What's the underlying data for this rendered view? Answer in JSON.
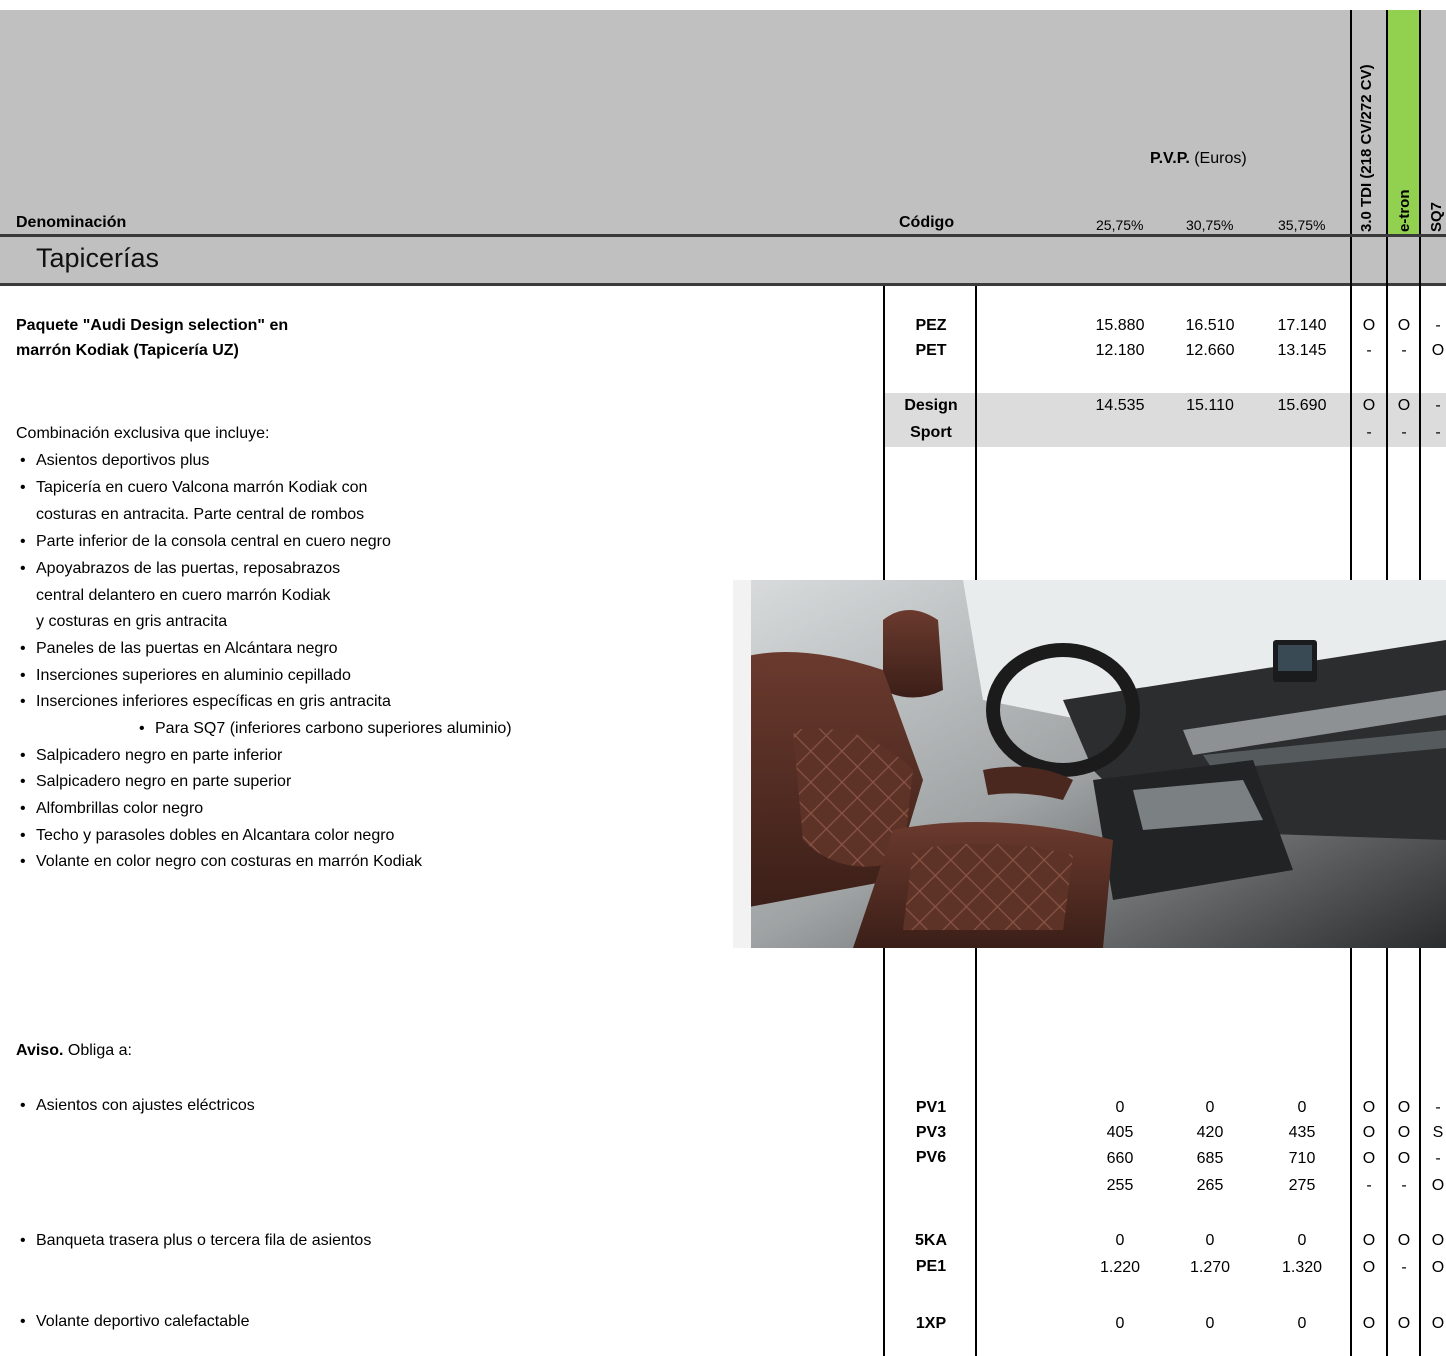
{
  "header": {
    "denominacion": "Denominación",
    "codigo": "Código",
    "pvp_bold": "P.V.P.",
    "pvp_unit": " (Euros)",
    "percents": [
      "25,75%",
      "30,75%",
      "35,75%"
    ],
    "engines": [
      "3.0 TDI (218 CV/272 CV)",
      "e-tron",
      "SQ7"
    ]
  },
  "colors": {
    "header_gray": "#c0c0c0",
    "etron_green": "#92d050",
    "design_band": "#dcdcdc"
  },
  "section": {
    "title": "Tapicerías"
  },
  "package": {
    "title_line1": "Paquete \"Audi Design selection\" en",
    "title_line2": "marrón Kodiak (Tapicería UZ)",
    "rows": [
      {
        "code": "PEZ",
        "prices": [
          "15.880",
          "16.510",
          "17.140"
        ],
        "avail": [
          "O",
          "O",
          "-"
        ]
      },
      {
        "code": "PET",
        "prices": [
          "12.180",
          "12.660",
          "13.145"
        ],
        "avail": [
          "-",
          "-",
          "O"
        ]
      },
      {
        "code": "Design",
        "prices": [
          "14.535",
          "15.110",
          "15.690"
        ],
        "avail": [
          "O",
          "O",
          "-"
        ]
      },
      {
        "code": "Sport",
        "prices": [
          "",
          "",
          ""
        ],
        "avail": [
          "-",
          "-",
          "-"
        ]
      }
    ]
  },
  "description": {
    "intro": "Combinación exclusiva que incluye:",
    "items": [
      "Asientos deportivos plus",
      "Tapicería en cuero Valcona marrón Kodiak con",
      "costuras en antracita. Parte central de rombos",
      "Parte inferior de la consola central en cuero negro",
      "Apoyabrazos de las puertas, reposabrazos",
      "central delantero en cuero marrón Kodiak",
      " y costuras en gris antracita",
      "Paneles de las puertas en Alcántara negro",
      "Inserciones superiores en aluminio cepillado",
      "Inserciones inferiores específicas en gris antracita",
      "Para SQ7 (inferiores carbono superiores aluminio)",
      "Salpicadero negro en parte inferior",
      "Salpicadero negro en parte superior",
      "Alfombrillas color negro",
      "Techo y parasoles dobles en Alcantara color negro",
      "Volante en color negro con costuras en marrón Kodiak"
    ]
  },
  "aviso": {
    "bold": "Aviso.",
    "text": " Obliga a:",
    "groups": [
      {
        "label": "Asientos con ajustes eléctricos",
        "rows": [
          {
            "code": "PV1",
            "prices": [
              "0",
              "0",
              "0"
            ],
            "avail": [
              "O",
              "O",
              "-"
            ]
          },
          {
            "code": "PV3",
            "prices": [
              "405",
              "420",
              "435"
            ],
            "avail": [
              "O",
              "O",
              "S"
            ]
          },
          {
            "code": "PV6",
            "prices": [
              "660",
              "685",
              "710"
            ],
            "avail": [
              "O",
              "O",
              "-"
            ]
          },
          {
            "code": "",
            "prices": [
              "255",
              "265",
              "275"
            ],
            "avail": [
              "-",
              "-",
              "O"
            ]
          }
        ]
      },
      {
        "label": "Banqueta trasera plus o tercera fila de asientos",
        "rows": [
          {
            "code": "5KA",
            "prices": [
              "0",
              "0",
              "0"
            ],
            "avail": [
              "O",
              "O",
              "O"
            ]
          },
          {
            "code": "PE1",
            "prices": [
              "1.220",
              "1.270",
              "1.320"
            ],
            "avail": [
              "O",
              "-",
              "O"
            ]
          }
        ]
      },
      {
        "label": "Volante deportivo calefactable",
        "rows": [
          {
            "code": "1XP",
            "prices": [
              "0",
              "0",
              "0"
            ],
            "avail": [
              "O",
              "O",
              "O"
            ]
          }
        ]
      }
    ]
  },
  "image": {
    "alt": "interior-photo"
  }
}
